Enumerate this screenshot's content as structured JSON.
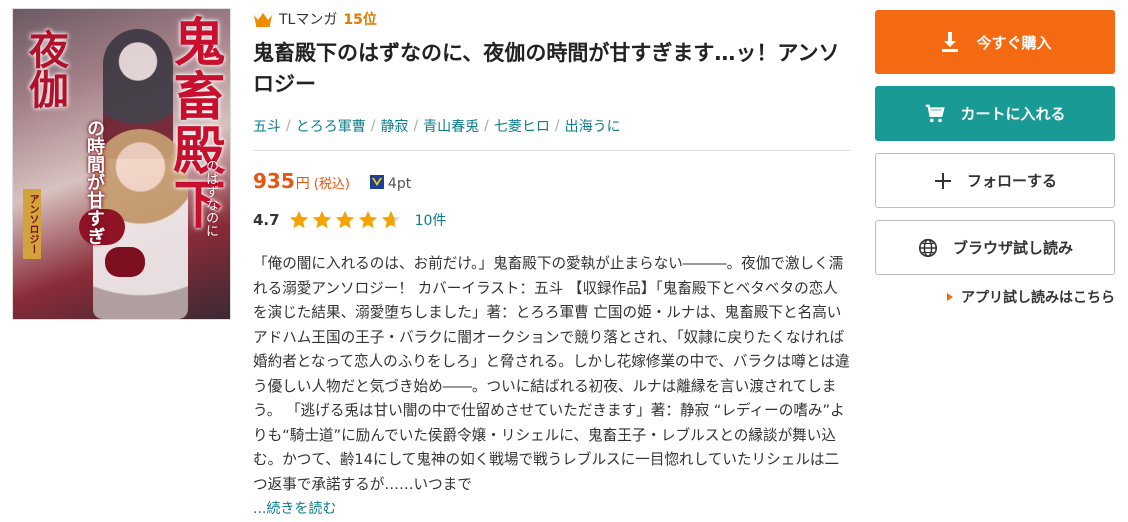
{
  "cover": {
    "title_big": "鬼畜殿下",
    "title_left": "夜伽",
    "title_mid": "の時間が甘すぎ",
    "title_small": "のはずなのに",
    "badge": "アンソロジー"
  },
  "ranking": {
    "category": "TLマンガ",
    "rank": "15位",
    "icon": "crown-icon",
    "icon_color": "#f08c00"
  },
  "book": {
    "title": "鬼畜殿下のはずなのに、夜伽の時間が甘すぎます…ッ！アンソロジー",
    "authors": [
      "五斗",
      "とろろ軍曹",
      "静寂",
      "青山春兎",
      "七菱ヒロ",
      "出海うに"
    ],
    "price": "935",
    "yen": "円",
    "tax": "(税込)",
    "points": "4pt",
    "rating": "4.7",
    "stars": 4.7,
    "reviews": "10件",
    "description": "「俺の闇に入れるのは、お前だけ。」鬼畜殿下の愛執が止まらない―――。夜伽で激しく濡れる溺愛アンソロジー！ カバーイラスト：五斗 【収録作品】「鬼畜殿下とベタベタの恋人を演じた結果、溺愛堕ちしました」著：とろろ軍曹 亡国の姫・ルナは、鬼畜殿下と名高いアドハム王国の王子・バラクに闇オークションで競り落とされ、「奴隷に戻りたくなければ婚約者となって恋人のふりをしろ」と脅される。しかし花嫁修業の中で、バラクは噂とは違う優しい人物だと気づき始め――。ついに結ばれる初夜、ルナは離縁を言い渡されてしまう。 「逃げる兎は甘い闇の中で仕留めさせていただきます」著：静寂 “レディーの嗜み”よりも“騎士道”に励んでいた侯爵令嬢・リシェルに、鬼畜王子・レブルスとの縁談が舞い込む。かつて、齢14にして鬼神の如く戦場で戦うレブルスに一目惚れしていたリシェルは二つ返事で承諾するが……いつまで",
    "read_more": "...続きを読む"
  },
  "actions": {
    "buy": "今すぐ購入",
    "cart": "カートに入れる",
    "follow": "フォローする",
    "trial": "ブラウザ試し読み",
    "app_trial": "アプリ試し読みはこちら"
  },
  "colors": {
    "buy": "#f46a12",
    "cart": "#1a9a95",
    "price": "#e8560f",
    "link": "#0b7d8c",
    "star": "#f5a300"
  }
}
